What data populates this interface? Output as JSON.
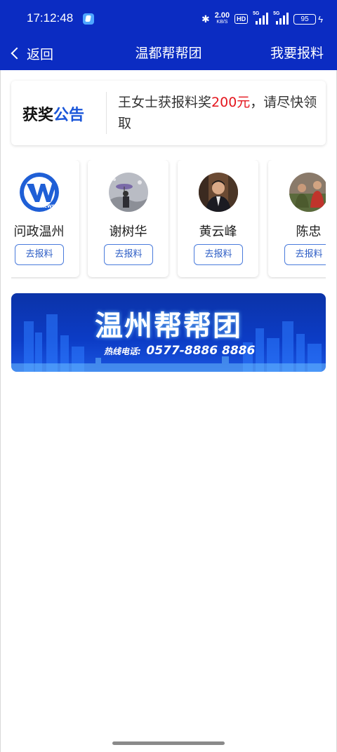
{
  "status_bar": {
    "time": "17:12:48",
    "net_speed_value": "2.00",
    "net_speed_unit": "KB/S",
    "hd": "HD",
    "sig1_gen": "5G",
    "sig2_gen": "5G",
    "battery": "95"
  },
  "nav": {
    "back_label": "返回",
    "title": "温都帮帮团",
    "report_label": "我要报料"
  },
  "notice": {
    "tag_part1": "获奖",
    "tag_part2": "公告",
    "text_before": "王女士获报料奖",
    "amount": "200元",
    "text_after": "，请尽快领取"
  },
  "reporters": [
    {
      "name": "问政温州",
      "button": "去报料"
    },
    {
      "name": "谢树华",
      "button": "去报料"
    },
    {
      "name": "黄云峰",
      "button": "去报料"
    },
    {
      "name": "陈忠",
      "button": "去报料"
    }
  ],
  "banner": {
    "title": "温州帮帮团",
    "hotline_label": "热线电话:",
    "hotline_number": "0577-8886 8886"
  },
  "colors": {
    "brand_blue": "#0b2cc2",
    "accent_red": "#e4161e",
    "link_blue": "#1a56d9"
  }
}
